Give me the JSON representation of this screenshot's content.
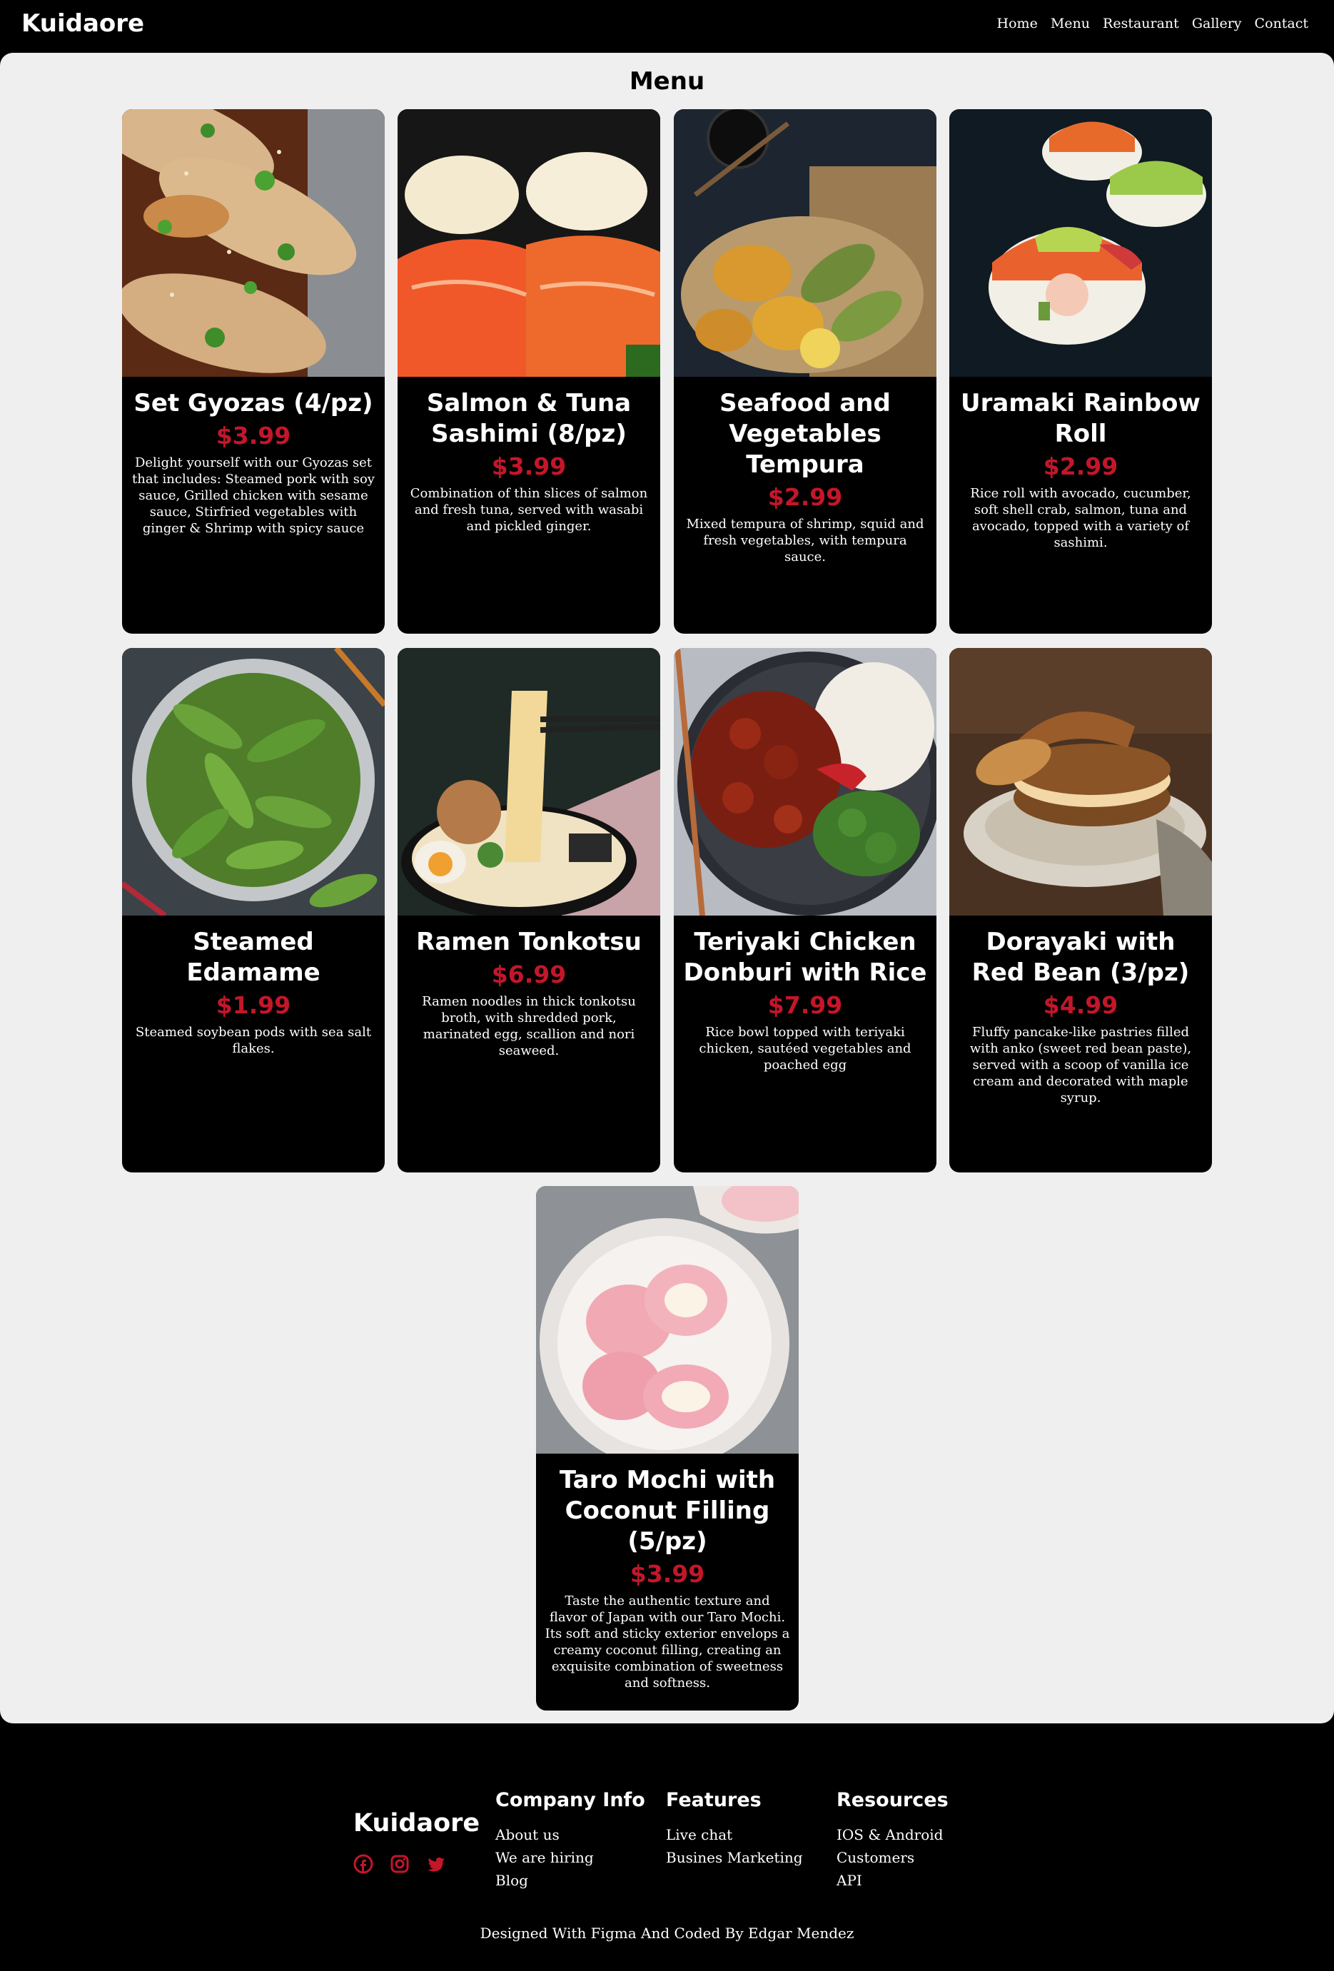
{
  "header": {
    "logo": "Kuidaore",
    "nav": [
      "Home",
      "Menu",
      "Restaurant",
      "Gallery",
      "Contact"
    ]
  },
  "menu": {
    "title": "Menu",
    "price_color": "#c4162a",
    "items": [
      {
        "name": "Set Gyozas (4/pz)",
        "price": "$3.99",
        "description": "Delight yourself with our Gyozas set that includes: Steamed pork with soy sauce, Grilled chicken with sesame sauce, Stirfried vegetables with ginger & Shrimp with spicy sauce",
        "image": "gyoza-photo"
      },
      {
        "name": "Salmon & Tuna Sashimi (8/pz)",
        "price": "$3.99",
        "description": "Combination of thin slices of salmon and fresh tuna, served with wasabi and pickled ginger.",
        "image": "sashimi-photo"
      },
      {
        "name": "Seafood and Vegetables Tempura",
        "price": "$2.99",
        "description": "Mixed tempura of shrimp, squid and fresh vegetables, with tempura sauce.",
        "image": "tempura-photo"
      },
      {
        "name": "Uramaki Rainbow Roll",
        "price": "$2.99",
        "description": "Rice roll with avocado, cucumber, soft shell crab, salmon, tuna and avocado, topped with a variety of sashimi.",
        "image": "uramaki-photo"
      },
      {
        "name": "Steamed Edamame",
        "price": "$1.99",
        "description": "Steamed soybean pods with sea salt flakes.",
        "image": "edamame-photo"
      },
      {
        "name": "Ramen Tonkotsu",
        "price": "$6.99",
        "description": "Ramen noodles in thick tonkotsu broth, with shredded pork, marinated egg, scallion and nori seaweed.",
        "image": "ramen-photo"
      },
      {
        "name": "Teriyaki Chicken Donburi with Rice",
        "price": "$7.99",
        "description": "Rice bowl topped with teriyaki chicken, sautéed vegetables and poached egg",
        "image": "donburi-photo"
      },
      {
        "name": "Dorayaki with Red Bean (3/pz)",
        "price": "$4.99",
        "description": "Fluffy pancake-like pastries filled with anko (sweet red bean paste), served with a scoop of vanilla ice cream and decorated with maple syrup.",
        "image": "dorayaki-photo"
      },
      {
        "name": "Taro Mochi with Coconut Filling (5/pz)",
        "price": "$3.99",
        "description": "Taste the authentic texture and flavor of Japan with our Taro Mochi. Its soft and sticky exterior envelops a creamy coconut filling, creating an exquisite combination of sweetness and softness.",
        "image": "mochi-photo"
      }
    ]
  },
  "footer": {
    "brand": "Kuidaore",
    "social": [
      "facebook-icon",
      "instagram-icon",
      "twitter-icon"
    ],
    "social_color": "#c4162a",
    "columns": [
      {
        "title": "Company Info",
        "links": [
          "About us",
          "We are hiring",
          "Blog"
        ]
      },
      {
        "title": "Features",
        "links": [
          "Live chat",
          "Busines Marketing"
        ]
      },
      {
        "title": "Resources",
        "links": [
          "IOS & Android",
          "Customers",
          "API"
        ]
      }
    ],
    "credit": "Designed With Figma And Coded By Edgar Mendez"
  }
}
